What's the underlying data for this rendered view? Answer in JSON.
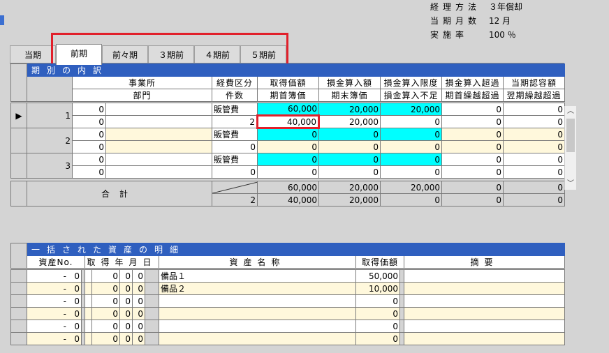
{
  "info": {
    "method_label": "経理方法",
    "method_value": "３年償却",
    "months_label": "当期月数",
    "months_value": "12 月",
    "rate_label": "実施率",
    "rate_value": "100 ％"
  },
  "tabs": [
    "当期",
    "前期",
    "前々期",
    "３期前",
    "４期前",
    "５期前"
  ],
  "active_tab": "前期",
  "highlight_color": "#e1202b",
  "period_table": {
    "title": "期別の内訳",
    "headers_row1": [
      "事業所",
      "経費区分",
      "取得価額",
      "損金算入額",
      "損金算入限度",
      "損金算入超過",
      "当期認容額"
    ],
    "headers_row2": [
      "部門",
      "件数",
      "期首簿価",
      "期末簿価",
      "損金算入不足",
      "期首繰越超過",
      "翌期繰越超過"
    ],
    "rows": [
      {
        "no": "1",
        "office": "0",
        "dept": "0",
        "category": "販管費",
        "count": "2",
        "acq": "60,000",
        "open": "40,000",
        "deduct": "20,000",
        "close": "20,000",
        "limit": "20,000",
        "short": "0",
        "excess": "0",
        "fwd_open": "0",
        "allow": "0",
        "fwd_next": "0"
      },
      {
        "no": "2",
        "office": "0",
        "dept": "0",
        "category": "販管費",
        "count": "0",
        "acq": "0",
        "open": "0",
        "deduct": "0",
        "close": "0",
        "limit": "0",
        "short": "0",
        "excess": "0",
        "fwd_open": "0",
        "allow": "0",
        "fwd_next": "0"
      },
      {
        "no": "3",
        "office": "0",
        "dept": "0",
        "category": "販管費",
        "count": "0",
        "acq": "0",
        "open": "0",
        "deduct": "0",
        "close": "0",
        "limit": "0",
        "short": "0",
        "excess": "0",
        "fwd_open": "0",
        "allow": "0",
        "fwd_next": "0"
      }
    ],
    "total": {
      "label": "合計",
      "count": "2",
      "acq": "60,000",
      "open": "40,000",
      "deduct": "20,000",
      "close": "20,000",
      "limit": "20,000",
      "short": "0",
      "excess": "0",
      "fwd_open": "0",
      "allow": "0",
      "fwd_next": "0"
    }
  },
  "asset_table": {
    "title": "一括された資産の明細",
    "headers": [
      "資産No.",
      "取得年月日",
      "資産名称",
      "取得価額",
      "摘要"
    ],
    "rows": [
      {
        "no": "0",
        "y": "0",
        "m": "0",
        "d": "0",
        "name": "備品１",
        "price": "50,000",
        "memo": ""
      },
      {
        "no": "0",
        "y": "0",
        "m": "0",
        "d": "0",
        "name": "備品２",
        "price": "10,000",
        "memo": ""
      },
      {
        "no": "0",
        "y": "0",
        "m": "0",
        "d": "0",
        "name": "",
        "price": "0",
        "memo": ""
      },
      {
        "no": "0",
        "y": "0",
        "m": "0",
        "d": "0",
        "name": "",
        "price": "0",
        "memo": ""
      },
      {
        "no": "0",
        "y": "0",
        "m": "0",
        "d": "0",
        "name": "",
        "price": "0",
        "memo": ""
      },
      {
        "no": "0",
        "y": "0",
        "m": "0",
        "d": "0",
        "name": "",
        "price": "0",
        "memo": ""
      }
    ]
  }
}
